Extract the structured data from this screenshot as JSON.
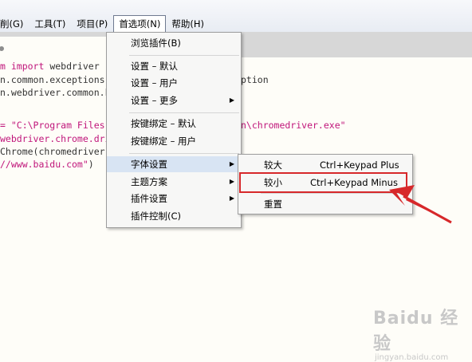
{
  "menubar": {
    "items": [
      "削(G)",
      "工具(T)",
      "项目(P)",
      "首选项(N)",
      "帮助(H)"
    ]
  },
  "code": {
    "lines": [
      {
        "pre": "",
        "kw": "m import",
        "rest": " webdriver"
      },
      {
        "pre": "",
        "kw": "",
        "rest": "n.common.exceptions",
        "tail": "ption"
      },
      {
        "pre": "",
        "kw": "",
        "rest": "n.webdriver.common.k"
      },
      {
        "pre": "",
        "kw": "",
        "rest": ""
      },
      {
        "pre": "",
        "kw": "",
        "rest": ""
      },
      {
        "pre": "",
        "str": "= \"C:\\Program Files",
        "tail": "n\\chromedriver.exe\""
      },
      {
        "pre": "",
        "fn": "webdriver.chrome.dri",
        "rest": ""
      },
      {
        "pre": "",
        "kw": "",
        "rest": "Chrome(chromedriver"
      },
      {
        "pre": "",
        "str": "//www.baidu.com\"",
        "rest": ")"
      }
    ]
  },
  "prefs_menu": {
    "items": [
      {
        "label": "浏览插件(B)",
        "submenu": false
      },
      {
        "label": "设置 – 默认",
        "submenu": false
      },
      {
        "label": "设置 – 用户",
        "submenu": false
      },
      {
        "label": "设置 – 更多",
        "submenu": true
      },
      {
        "label": "按键绑定 – 默认",
        "submenu": false
      },
      {
        "label": "按键绑定 – 用户",
        "submenu": false
      },
      {
        "label": "字体设置",
        "submenu": true
      },
      {
        "label": "主题方案",
        "submenu": true
      },
      {
        "label": "插件设置",
        "submenu": true
      },
      {
        "label": "插件控制(C)",
        "submenu": false
      }
    ]
  },
  "font_menu": {
    "items": [
      {
        "label": "较大",
        "shortcut": "Ctrl+Keypad Plus"
      },
      {
        "label": "较小",
        "shortcut": "Ctrl+Keypad Minus"
      },
      {
        "label": "重置",
        "shortcut": ""
      }
    ]
  },
  "watermark": {
    "brand": "Baidu 经验",
    "sub": "jingyan.baidu.com"
  },
  "colors": {
    "highlight": "#d8e4f3",
    "annotation": "#d7282a",
    "code_keyword": "#c0157a"
  }
}
